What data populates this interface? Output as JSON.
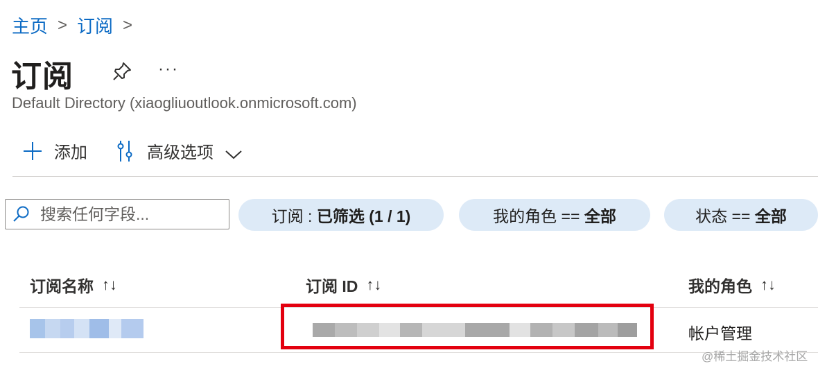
{
  "breadcrumb": {
    "items": [
      "主页",
      "订阅"
    ],
    "separator": ">"
  },
  "header": {
    "title": "订阅",
    "more": "···",
    "subtitle": "Default Directory (xiaogliuoutlook.onmicrosoft.com)"
  },
  "toolbar": {
    "add_label": "添加",
    "advanced_label": "高级选项"
  },
  "search": {
    "placeholder": "搜索任何字段..."
  },
  "filters": [
    {
      "key": "订阅 : ",
      "value": "已筛选 (1 / 1)"
    },
    {
      "key": "我的角色 == ",
      "value": "全部"
    },
    {
      "key": "状态 == ",
      "value": "全部"
    }
  ],
  "table": {
    "columns": [
      {
        "label": "订阅名称",
        "sort": "↑↓"
      },
      {
        "label": "订阅 ID",
        "sort": "↑↓"
      },
      {
        "label": "我的角色",
        "sort": "↑↓"
      }
    ],
    "rows": [
      {
        "name": "",
        "id": "",
        "role": "帐户管理"
      }
    ]
  },
  "watermark": "@稀土掘金技术社区",
  "colors": {
    "link": "#0b6ac4",
    "pill": "#ddeaf7",
    "highlight": "#e3000f"
  }
}
